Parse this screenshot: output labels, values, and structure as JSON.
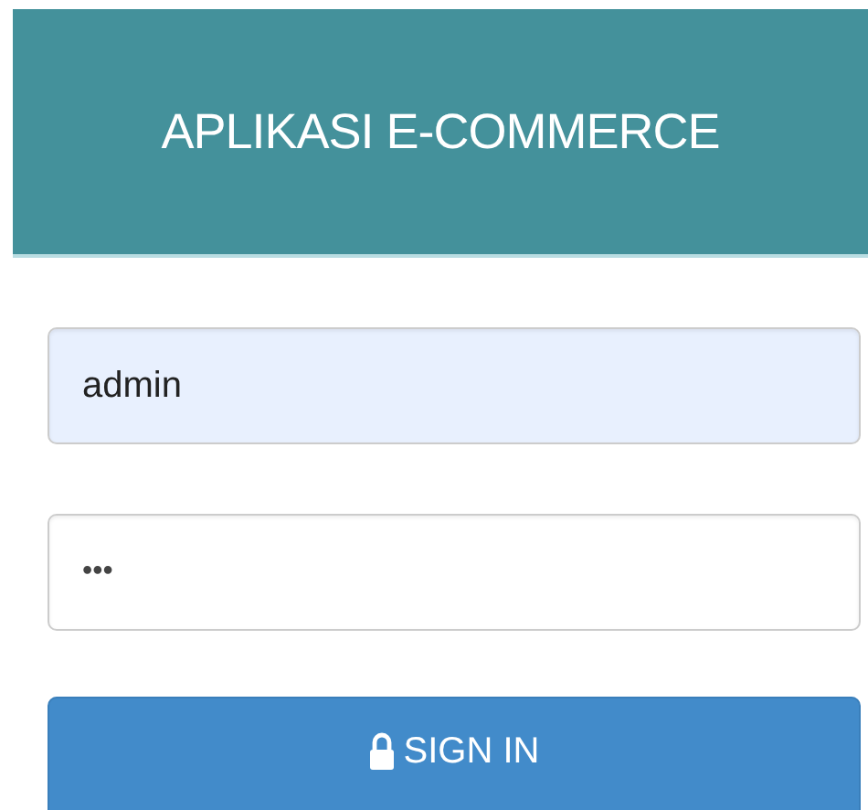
{
  "header": {
    "title": "APLIKASI E-COMMERCE"
  },
  "fields": [
    {
      "kind": "text",
      "value": "admin",
      "autofilled": true
    },
    {
      "kind": "password",
      "value": "•••",
      "autofilled": false
    }
  ],
  "button": {
    "label": "SIGN IN"
  }
}
